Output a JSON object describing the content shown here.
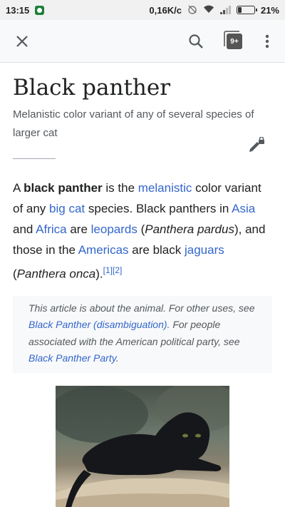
{
  "status_bar": {
    "time": "13:15",
    "network_speed": "0,16K/c",
    "battery_percent": "21%",
    "battery_level": 0.21
  },
  "toolbar": {
    "tab_count": "9+"
  },
  "article": {
    "title": "Black panther",
    "description": "Melanistic color variant of any of several species of larger cat",
    "intro": {
      "t1": "A ",
      "bold": "black panther",
      "t2": " is the ",
      "link_melanistic": "melanistic",
      "t3": " color variant of any ",
      "link_big_cat": "big cat",
      "t4": " species. Black panthers in ",
      "link_asia": "Asia",
      "t5": " and ",
      "link_africa": "Africa",
      "t6": " are ",
      "link_leopards": "leopards",
      "t7": " (",
      "italic_pardus": "Panthera pardus",
      "t8": "), and those in the ",
      "link_americas": "Americas",
      "t9": " are black ",
      "link_jaguars": "jaguars",
      "t10": " (",
      "italic_onca": "Panthera onca",
      "t11": ").",
      "ref1": "[1]",
      "ref2": "[2]"
    },
    "hatnote": {
      "t1": "This article is about the animal. For other uses, see ",
      "link1": "Black Panther (disambiguation)",
      "t2": ". For people associated with the American political party, see ",
      "link2": "Black Panther Party",
      "t3": "."
    }
  },
  "icons": {
    "close": "close-icon",
    "search": "search-icon",
    "tabs": "tabs-icon",
    "menu": "more-vert-icon",
    "edit": "edit-locked-icon"
  },
  "colors": {
    "link": "#3366cc",
    "text": "#202122",
    "subtle": "#54595d",
    "toolbar_bg": "#f8f9fa"
  }
}
